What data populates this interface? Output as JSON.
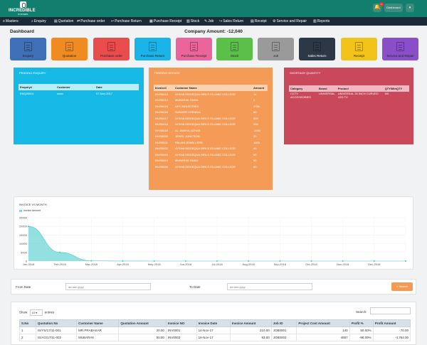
{
  "brand": {
    "name": "INCREDIBLE",
    "sub": "SYSTEMS"
  },
  "topbar": {
    "notif_count": "1",
    "dashboard_label": "Dashboard",
    "user_caret": "▾"
  },
  "menu": [
    {
      "icon": "≡",
      "label": "Masters"
    },
    {
      "icon": "⌕",
      "label": "Enquiry"
    },
    {
      "icon": "▤",
      "label": "Quotation"
    },
    {
      "icon": "⇄",
      "label": "Purchase order"
    },
    {
      "icon": "↩",
      "label": "Purchase Return"
    },
    {
      "icon": "▦",
      "label": "Purchase Receipt"
    },
    {
      "icon": "▥",
      "label": "Stock"
    },
    {
      "icon": "✎",
      "label": "Job"
    },
    {
      "icon": "↪",
      "label": "Sales Return"
    },
    {
      "icon": "▤",
      "label": "Receipt"
    },
    {
      "icon": "⚙",
      "label": "Service and Repair"
    },
    {
      "icon": "▥",
      "label": "Reports"
    }
  ],
  "page": {
    "title": "Dashboard",
    "company_amount": "Company Amount: -12,040"
  },
  "tiles": [
    {
      "label": "Enquiry",
      "color": "#3f6fb6"
    },
    {
      "label": "Quotation",
      "color": "#f08b22"
    },
    {
      "label": "Purchase order",
      "color": "#e84c4c"
    },
    {
      "label": "Purchase Return",
      "color": "#1ab4e8"
    },
    {
      "label": "Purchase Receipt",
      "color": "#e9659b"
    },
    {
      "label": "Stock",
      "color": "#5cbf4a"
    },
    {
      "label": "Job",
      "color": "#9a9a9a"
    },
    {
      "label": "Sales Return",
      "color": "#2c3845"
    },
    {
      "label": "Receipt",
      "color": "#f2c318"
    },
    {
      "label": "Service and Repair",
      "color": "#8a4fc8"
    }
  ],
  "pending_enquiry": {
    "title": "PENDING ENQUIRY",
    "headers": [
      "Enquiry#",
      "Customer",
      "Date"
    ],
    "rows": [
      [
        "ENQ00001",
        "www",
        "07-Nov-2017"
      ]
    ]
  },
  "pending_invoice": {
    "title": "PENDING INVOICE",
    "headers": [
      "Invoice#",
      "Customer Name",
      "Amount"
    ],
    "rows": [
      [
        "INV00013",
        "AYSHA SIDDEQUA GIRLS ISLAMIC COLLEGE",
        "14"
      ],
      [
        "INV00014",
        "MUBARAK EMAIL",
        "0"
      ],
      [
        "INV00015",
        "APS INDUSTRIES",
        "4750"
      ],
      [
        "INV00016",
        "SUNDER CHENNAI",
        "80"
      ],
      [
        "INV00017",
        "AYSHA SIDDEQUA GIRLS ISLAMIC COLLEGE",
        "500"
      ],
      [
        "INV00018",
        "AYSHA SIDDEQUA GIRLS ISLAMIC COLLEGE",
        "200"
      ],
      [
        "INV00019",
        "AL JAMIYA, AZHAR",
        "-1000"
      ],
      [
        "INV00020",
        "JEWEL JUNCTION",
        "20"
      ],
      [
        "INV00021",
        "PALANI JEWELLERS",
        "1000"
      ],
      [
        "INV00022",
        "AYSHA SIDDEQUA GIRLS ISLAMIC COLLEGE",
        "40"
      ],
      [
        "INV00023",
        "AYSHA SIDDEQUA GIRLS ISLAMIC COLLEGE",
        "90"
      ],
      [
        "INV00024",
        "MUBARAK EMAIL",
        "50"
      ],
      [
        "INV00025",
        "AYSHA SIDDEQUA GIRLS ISLAMIC COLLEGE",
        "60"
      ]
    ]
  },
  "shortage": {
    "title": "SHORTAGE QUANTITY",
    "headers": [
      "Category",
      "Brand",
      "Product",
      "QTY/MinQTY"
    ],
    "rows": [
      [
        "CCTV ACCESSORIES",
        "UNIVERSAL",
        "UNIVERSAL 32 INCH CURVED LED TV",
        "0/0"
      ]
    ]
  },
  "chart_data": {
    "type": "area",
    "title": "INVOICE VS MONTH",
    "series": [
      {
        "name": "Invoice Amount",
        "values": [
          20000,
          5000,
          150,
          20,
          0,
          0,
          0,
          0,
          0,
          0,
          0,
          0,
          0
        ]
      }
    ],
    "categories": [
      "Jan-2018",
      "Feb-2018",
      "Mar-2018",
      "Apr-2018",
      "May-2018",
      "Jun-2018",
      "Jul-2018",
      "Aug-2018",
      "Sep-2018",
      "Oct-2018",
      "Nov-2018",
      "Dec-2018",
      ""
    ],
    "xlabel": "",
    "ylabel": "",
    "ylim": [
      0,
      25000
    ],
    "yticks": [
      "0",
      "5000",
      "10000",
      "15000",
      "20000",
      "25000"
    ],
    "color": "#7fdbdb",
    "grid": true,
    "legend": "top-left"
  },
  "filter": {
    "from_label": "From Date",
    "from_placeholder": "dd-mm-yyyy",
    "to_label": "To Date",
    "to_placeholder": "dd-mm-yyyy",
    "search_label": "Search"
  },
  "table": {
    "show_label": "Show",
    "page_size": "10",
    "entries_label": "entries",
    "search_label": "Search:",
    "headers": [
      "S.No",
      "Quotation No",
      "Customer Name",
      "Quotation Amount",
      "Invoice NO",
      "Invoice Date",
      "Invoice Amount",
      "Job ID",
      "Project Cost Amount",
      "Profit %",
      "Profit Amount"
    ],
    "rows": [
      [
        "1",
        "IS/YS/17/11-001",
        "MR.PRABAKAR",
        "20.00",
        "INV0001",
        "14-Nov-17",
        "210.00",
        "JOB0001",
        "140",
        "50.00%",
        "70.00"
      ],
      [
        "2",
        "IS/AG/17/11-002",
        "MUBARAK",
        "50.00",
        "INV0003",
        "16-Nov-17",
        "93.00",
        "JOB0002",
        "4857",
        "-98.09%",
        "-4,764.00"
      ]
    ]
  }
}
